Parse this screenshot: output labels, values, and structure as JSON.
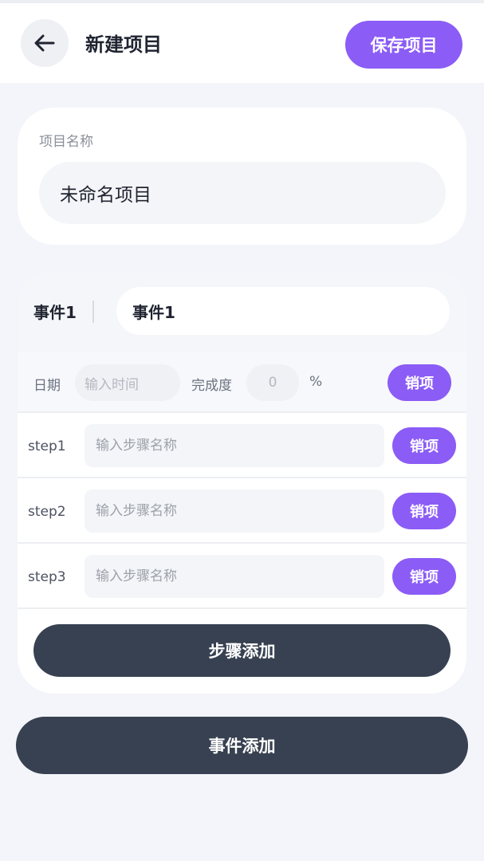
{
  "header": {
    "title": "新建项目",
    "save_label": "保存项目",
    "back_icon": "arrow-left-icon"
  },
  "project": {
    "name_label": "项目名称",
    "name_value": "未命名项目"
  },
  "event": {
    "label": "事件1",
    "name_value": "事件1",
    "date_label": "日期",
    "date_placeholder": "输入时间",
    "completion_label": "完成度",
    "completion_value": "0",
    "percent_unit": "%",
    "remove_label": "销项",
    "steps": [
      {
        "label": "step1",
        "placeholder": "输入步骤名称",
        "remove_label": "销项"
      },
      {
        "label": "step2",
        "placeholder": "输入步骤名称",
        "remove_label": "销项"
      },
      {
        "label": "step3",
        "placeholder": "输入步骤名称",
        "remove_label": "销项"
      }
    ],
    "add_step_label": "步骤添加"
  },
  "add_event_label": "事件添加",
  "colors": {
    "accent": "#8b5cf6",
    "dark_button": "#374151",
    "background": "#f4f5fa"
  }
}
